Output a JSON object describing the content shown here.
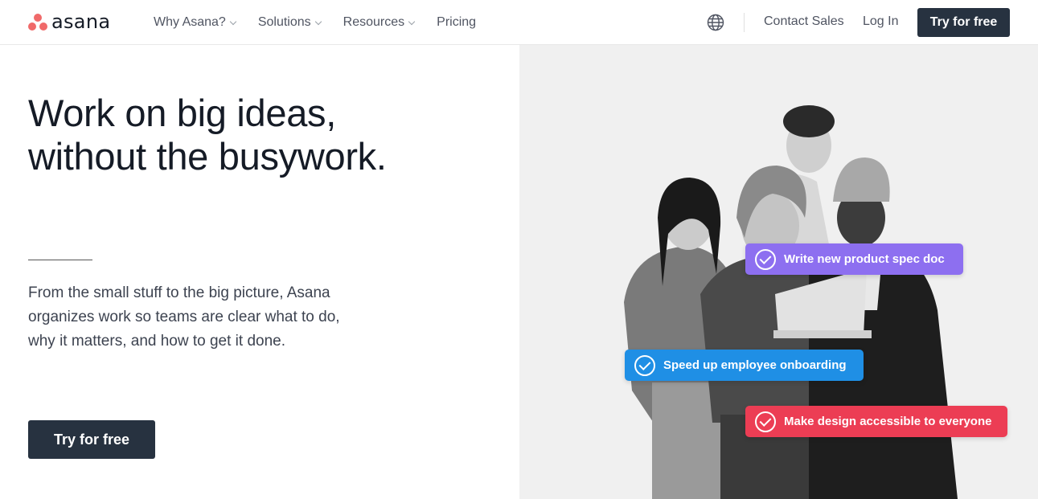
{
  "nav": {
    "logo_text": "asana",
    "links": [
      {
        "label": "Why Asana?",
        "has_dropdown": true
      },
      {
        "label": "Solutions",
        "has_dropdown": true
      },
      {
        "label": "Resources",
        "has_dropdown": true
      },
      {
        "label": "Pricing",
        "has_dropdown": false
      }
    ],
    "globe_icon": "globe-icon",
    "contact_sales": "Contact Sales",
    "log_in": "Log In",
    "cta": "Try for free"
  },
  "hero": {
    "headline_line1": "Work on big ideas,",
    "headline_line2": "without the busywork.",
    "subtext": "From the small stuff to the big picture, Asana organizes work so teams are clear what to do, why it matters, and how to get it done.",
    "cta": "Try for free"
  },
  "tasks": [
    {
      "label": "Write new product spec doc",
      "color": "#8d6ff0"
    },
    {
      "label": "Speed up employee onboarding",
      "color": "#1f8fe5"
    },
    {
      "label": "Make design accessible to everyone",
      "color": "#ec3d54"
    }
  ],
  "colors": {
    "brand_coral": "#f06a6a",
    "button_dark": "#273240",
    "panel_bg": "#f0f0f0"
  }
}
